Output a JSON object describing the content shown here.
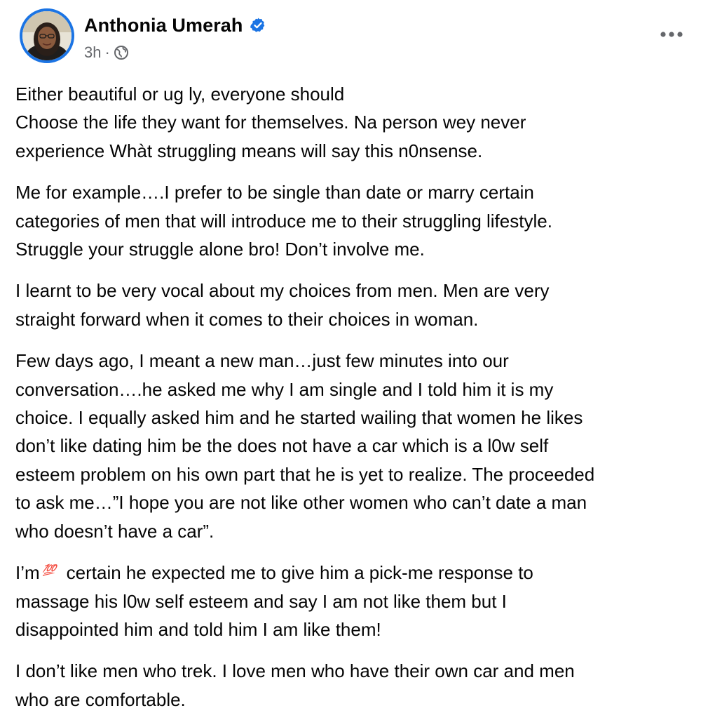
{
  "post": {
    "author": {
      "name": "Anthonia Umerah",
      "verified_icon": "verified-badge-icon",
      "avatar_icon": "profile-avatar"
    },
    "meta": {
      "time": "3h",
      "separator": "·",
      "audience_icon": "globe-icon"
    },
    "more_icon": "more-options-icon",
    "colors": {
      "accent": "#1b74e4",
      "text": "#050505",
      "secondary_text": "#65676b",
      "background": "#ffffff"
    },
    "body": {
      "p1": [
        "Either beautiful or ug ly, everyone should",
        "Choose the life they want for themselves. Na person wey never",
        "experience Whàt struggling means will say this n0nsense."
      ],
      "p2": [
        "Me for example….I prefer to be single than date or marry certain",
        "categories of men that will introduce me to their struggling lifestyle.",
        "Struggle your struggle alone bro! Don’t involve me."
      ],
      "p3": [
        "I learnt to be very vocal about my choices from men. Men are very",
        "straight forward when it comes to their choices in woman."
      ],
      "p4": [
        "Few days ago, I meant a new man…just few minutes into our",
        "conversation….he asked me why I am single and I told him it is my",
        "choice. I equally asked him and he started wailing that women he likes",
        "don’t like dating him be the does not have a car which is a l0w self",
        "esteem problem on his own part that he is yet to realize. The proceeded",
        "to ask me…”I hope you are not like other women who can’t date a man",
        "who doesn’t have a car”."
      ],
      "p5": {
        "line1_before": "I’m",
        "emoji": "💯",
        "line1_after": "certain he expected me to give him a pick-me response to",
        "line2": "massage his l0w self esteem and say I am not like them but I",
        "line3": "disappointed him and told him I am like them!"
      },
      "p6": [
        "I don’t like men who trek. I love men who have their own car and men",
        "who are comfortable."
      ]
    }
  }
}
